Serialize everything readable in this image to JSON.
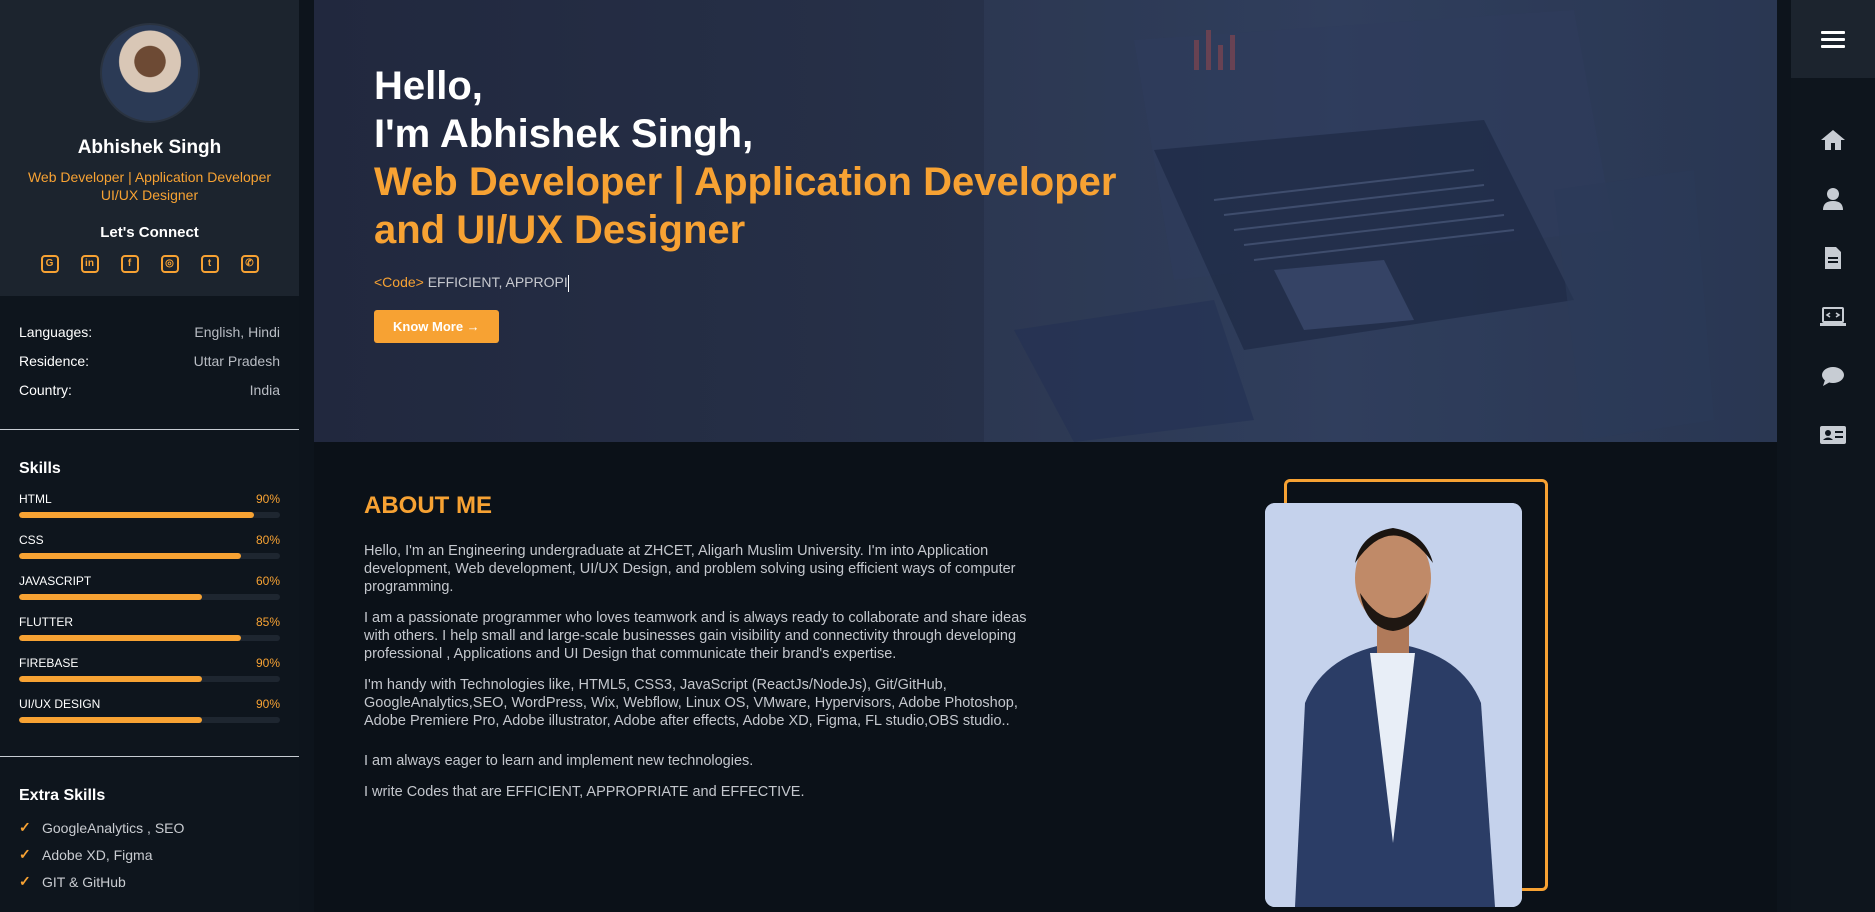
{
  "profile": {
    "name": "Abhishek Singh",
    "role_line1": "Web Developer | Application Developer",
    "role_line2": "UI/UX Designer",
    "connect_title": "Let's Connect",
    "social": [
      {
        "icon": "github-icon"
      },
      {
        "icon": "linkedin-icon"
      },
      {
        "icon": "facebook-icon"
      },
      {
        "icon": "instagram-icon"
      },
      {
        "icon": "twitter-icon"
      },
      {
        "icon": "whatsapp-icon"
      }
    ]
  },
  "info": [
    {
      "key": "Languages:",
      "value": "English, Hindi"
    },
    {
      "key": "Residence:",
      "value": "Uttar Pradesh"
    },
    {
      "key": "Country:",
      "value": "India"
    }
  ],
  "skills": {
    "title": "Skills",
    "items": [
      {
        "name": "HTML",
        "percent": "90%",
        "fill": 0.9
      },
      {
        "name": "CSS",
        "percent": "80%",
        "fill": 0.85
      },
      {
        "name": "JAVASCRIPT",
        "percent": "60%",
        "fill": 0.7
      },
      {
        "name": "FLUTTER",
        "percent": "85%",
        "fill": 0.85
      },
      {
        "name": "FIREBASE",
        "percent": "90%",
        "fill": 0.7
      },
      {
        "name": "UI/UX DESIGN",
        "percent": "90%",
        "fill": 0.7
      }
    ]
  },
  "extra_skills": {
    "title": "Extra Skills",
    "items": [
      "GoogleAnalytics , SEO",
      "Adobe XD, Figma",
      "GIT & GitHub"
    ]
  },
  "hero": {
    "line1": "Hello,",
    "line2": "I'm Abhishek Singh,",
    "line3": "Web Developer | Application Developer",
    "line4": "and UI/UX Designer",
    "code_tag": "<Code>",
    "typed_text": " EFFICIENT, APPROPI",
    "button_label": "Know More →"
  },
  "about": {
    "title": "ABOUT ME",
    "paragraphs": [
      "Hello, I'm an Engineering undergraduate at ZHCET, Aligarh Muslim University. I'm into Application development, Web development, UI/UX Design, and problem solving using efficient ways of computer programming.",
      "I am a passionate programmer who loves teamwork and is always ready to collaborate and share ideas with others. I help small and large-scale businesses gain visibility and connectivity through developing professional , Applications and UI Design that communicate their brand's expertise.",
      "I'm handy with Technologies like, HTML5, CSS3, JavaScript (ReactJs/NodeJs), Git/GitHub, GoogleAnalytics,SEO, WordPress, Wix, Webflow, Linux OS, VMware, Hypervisors, Adobe Photoshop, Adobe Premiere Pro, Adobe illustrator, Adobe after effects, Adobe XD, Figma, FL studio,OBS studio..",
      "I am always eager to learn and implement new technologies.",
      "I write Codes that are EFFICIENT, APPROPRIATE and EFFECTIVE."
    ]
  },
  "rightnav": {
    "items": [
      "home-icon",
      "user-icon",
      "file-icon",
      "laptop-code-icon",
      "comment-icon",
      "id-card-icon"
    ]
  },
  "colors": {
    "accent": "#f7a233",
    "sidebar_top": "#1c242e",
    "background": "#0b1118"
  }
}
